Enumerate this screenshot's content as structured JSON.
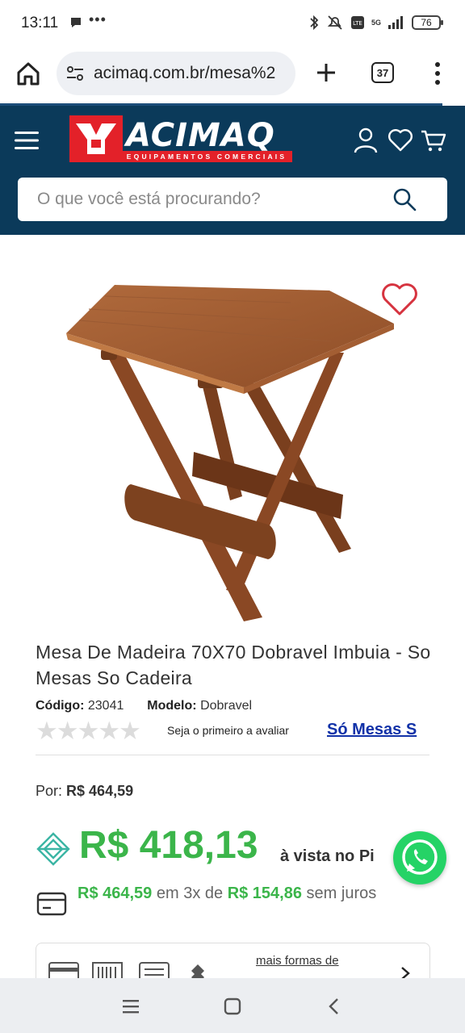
{
  "status_bar": {
    "time": "13:11",
    "net_label": "5G",
    "battery": "76"
  },
  "browser": {
    "url": "acimaq.com.br/mesa%2",
    "tab_count": "37"
  },
  "site": {
    "logo_word": "ACIMAQ",
    "logo_tagline": "EQUIPAMENTOS COMERCIAIS",
    "header_color": "#0b3a5a",
    "brand_red": "#e32129",
    "search_placeholder": "O que você está procurando?"
  },
  "product": {
    "title": "Mesa De Madeira 70X70 Dobravel Imbuia - So Mesas So Cadeira",
    "code_label": "Código:",
    "code_value": "23041",
    "model_label": "Modelo:",
    "model_value": "Dobravel",
    "rating_stars": "★★★★★",
    "rating_prompt": "Seja o primeiro a avaliar",
    "brand_link": "Só Mesas S",
    "price_label": "Por:",
    "price_regular": "R$ 464,59",
    "price_cash": "R$ 418,13",
    "price_cash_suffix": "à vista no Pi",
    "installment_total": "R$ 464,59",
    "installment_middle": "em 3x de",
    "installment_value": "R$ 154,86",
    "installment_suffix": "sem juros",
    "more_payment": "mais formas de",
    "price_color": "#3bb54a"
  }
}
